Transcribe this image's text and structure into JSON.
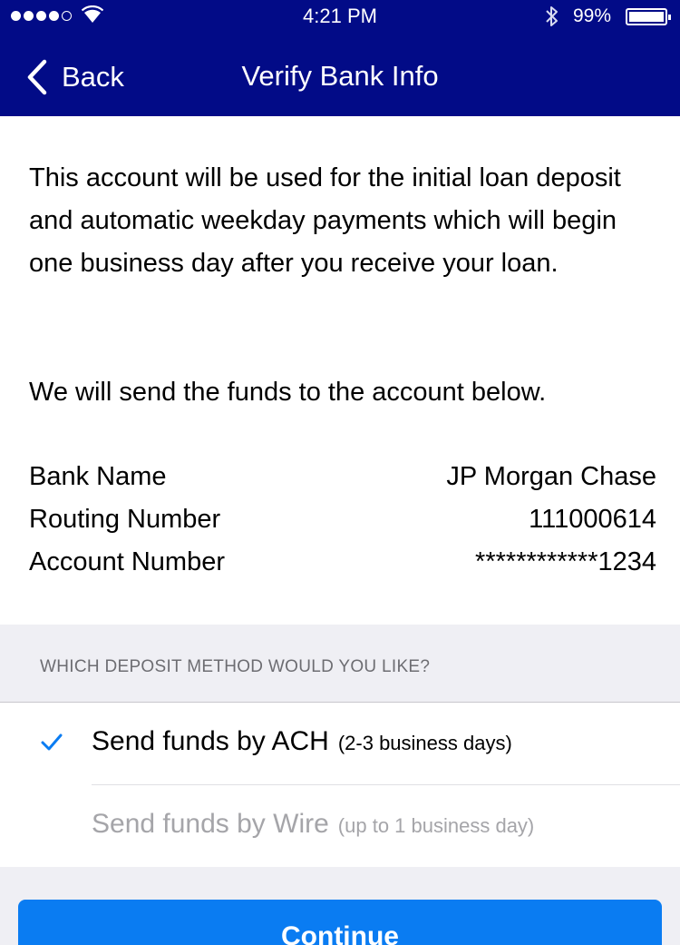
{
  "status_bar": {
    "time": "4:21 PM",
    "battery_percent": "99%",
    "battery_level": 0.99,
    "signal_bars_filled": 4,
    "signal_bars_total": 5,
    "icons": [
      "signal-icon",
      "wifi-icon",
      "bluetooth-icon",
      "battery-icon"
    ]
  },
  "nav": {
    "back_label": "Back",
    "title": "Verify Bank Info",
    "background_color": "#020b87"
  },
  "intro": {
    "paragraph1": "This account will be used for the initial loan deposit and automatic weekday payments which will begin one business day after you receive your loan.",
    "paragraph2": "We will send the funds to the account below."
  },
  "bank_details": [
    {
      "label": "Bank Name",
      "value": "JP Morgan Chase"
    },
    {
      "label": "Routing Number",
      "value": "111000614"
    },
    {
      "label": "Account Number",
      "value": "************1234"
    }
  ],
  "deposit_method": {
    "section_title": "WHICH DEPOSIT METHOD WOULD YOU LIKE?",
    "options": [
      {
        "label": "Send funds by ACH",
        "sublabel": "(2-3 business days)",
        "selected": true,
        "enabled": true
      },
      {
        "label": "Send funds by Wire",
        "sublabel": "(up to 1 business day)",
        "selected": false,
        "enabled": false
      }
    ],
    "check_color": "#0a7cf2"
  },
  "continue_button": {
    "label": "Continue",
    "color": "#0a7cf2"
  }
}
